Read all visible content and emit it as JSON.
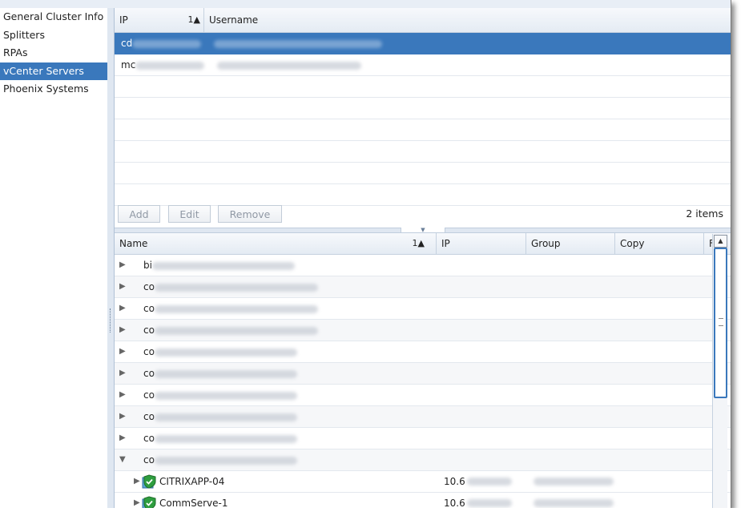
{
  "sidebar": {
    "items": [
      {
        "label": "General Cluster Info"
      },
      {
        "label": "Splitters"
      },
      {
        "label": "RPAs"
      },
      {
        "label": "vCenter Servers"
      },
      {
        "label": "Phoenix Systems"
      }
    ],
    "selected": "vCenter Servers"
  },
  "servers_table": {
    "columns": {
      "ip": "IP",
      "ip_sort": "1▲",
      "username": "Username"
    },
    "rows": [
      {
        "ip_prefix": "cd",
        "selected": true
      },
      {
        "ip_prefix": "mc",
        "selected": false
      }
    ]
  },
  "toolbar": {
    "add_label": "Add",
    "edit_label": "Edit",
    "remove_label": "Remove",
    "count": "2 items"
  },
  "vm_tree": {
    "columns": {
      "name": "Name",
      "name_sort": "1▲",
      "ip": "IP",
      "group": "Group",
      "copy": "Copy",
      "extra": "F"
    },
    "hosts": [
      {
        "prefix": "bi",
        "expanded": false
      },
      {
        "prefix": "co",
        "expanded": false
      },
      {
        "prefix": "co",
        "expanded": false
      },
      {
        "prefix": "co",
        "expanded": false
      },
      {
        "prefix": "co",
        "expanded": false
      },
      {
        "prefix": "co",
        "expanded": false
      },
      {
        "prefix": "co",
        "expanded": false
      },
      {
        "prefix": "co",
        "expanded": false
      },
      {
        "prefix": "co",
        "expanded": false
      },
      {
        "prefix": "co",
        "expanded": true
      }
    ],
    "vms": [
      {
        "name": "CITRIXAPP-04",
        "ip_prefix": "10.6"
      },
      {
        "name": "CommServe-1",
        "ip_prefix": "10.6"
      }
    ]
  },
  "icons": {
    "collapsed": "▶",
    "expanded": "▼",
    "vm": "vm-protected-shield-icon"
  },
  "colors": {
    "selection": "#3a78bc",
    "shield": "#2e9e3f",
    "vm_box": "#5ba6d8"
  }
}
